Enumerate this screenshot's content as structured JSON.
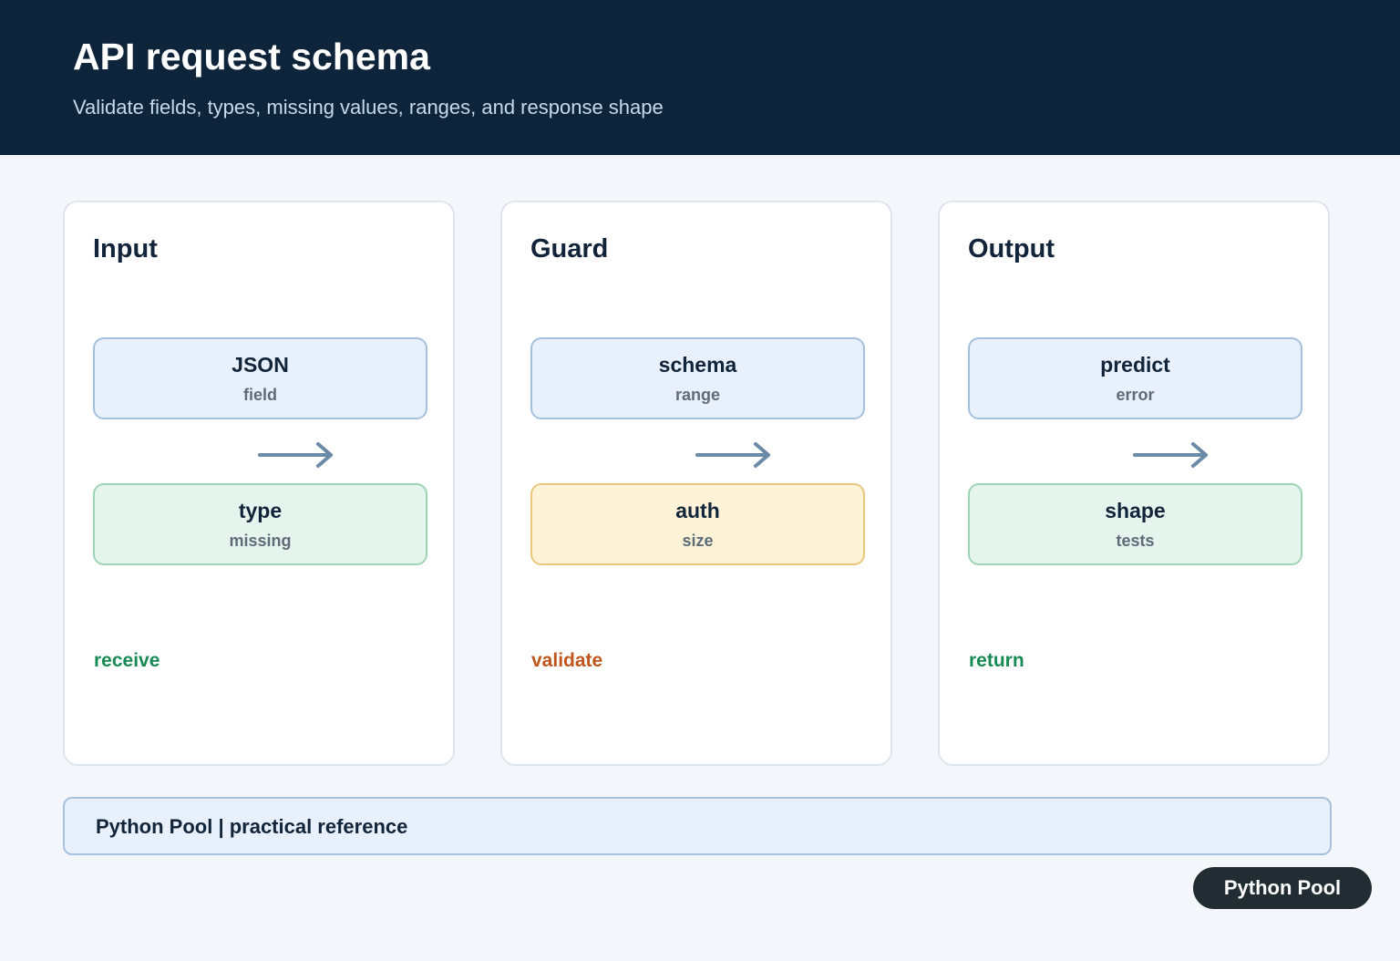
{
  "header": {
    "title": "API request schema",
    "subtitle": "Validate fields, types, missing values, ranges, and response shape"
  },
  "panels": [
    {
      "title": "Input",
      "top_box": {
        "label": "JSON",
        "sub": "field"
      },
      "bottom_box": {
        "label": "type",
        "sub": "missing"
      },
      "footer_label": "receive"
    },
    {
      "title": "Guard",
      "top_box": {
        "label": "schema",
        "sub": "range"
      },
      "bottom_box": {
        "label": "auth",
        "sub": "size"
      },
      "footer_label": "validate"
    },
    {
      "title": "Output",
      "top_box": {
        "label": "predict",
        "sub": "error"
      },
      "bottom_box": {
        "label": "shape",
        "sub": "tests"
      },
      "footer_label": "return"
    }
  ],
  "footer": {
    "text": "Python Pool | practical reference"
  },
  "badge": {
    "text": "Python Pool"
  },
  "colors": {
    "header_bg": "#0e243a",
    "green_label": "#1a8a55",
    "orange_label": "#c0561c",
    "arrow": "#6b8aa8"
  }
}
